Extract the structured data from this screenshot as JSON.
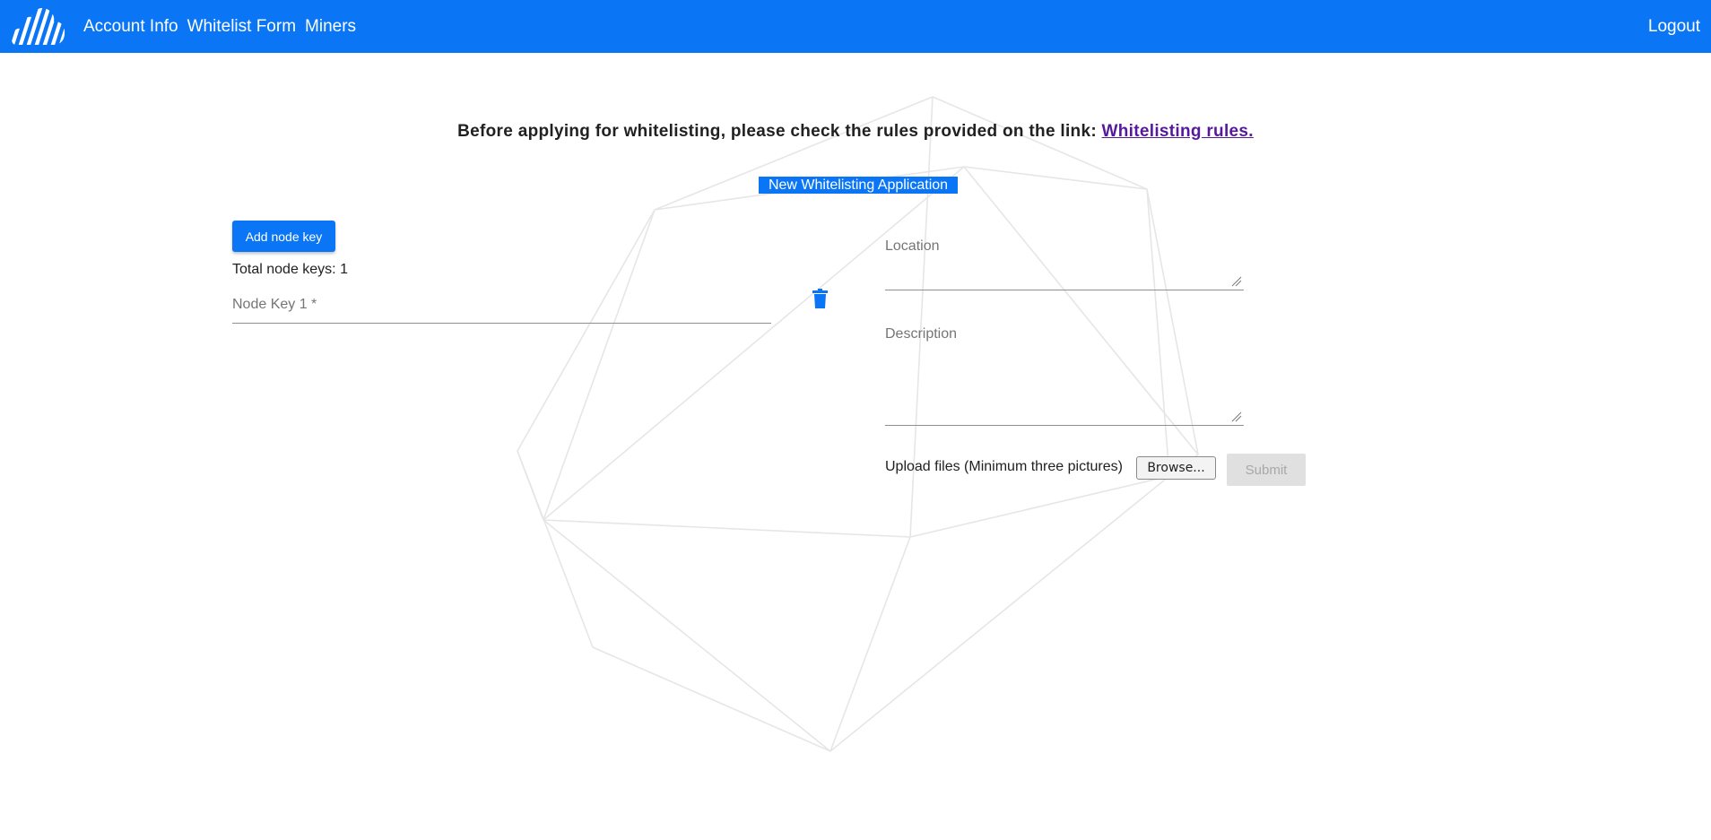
{
  "nav": {
    "logo_icon": "cloud-stripes-icon",
    "links": [
      {
        "label": "Account Info"
      },
      {
        "label": "Whitelist Form"
      },
      {
        "label": "Miners"
      }
    ],
    "logout_label": "Logout"
  },
  "notice": {
    "text": "Before applying for whitelisting, please check the rules provided on the link: ",
    "link_label": "Whitelisting rules."
  },
  "form": {
    "title": "New Whitelisting Application",
    "add_key_label": "Add node key",
    "total_keys_text": "Total node keys: 1",
    "node_key_label": "Node Key 1 *",
    "node_key_value": "",
    "delete_icon": "trash-icon",
    "location_label": "Location",
    "location_value": "",
    "description_label": "Description",
    "description_value": "",
    "upload_label": "Upload files (Minimum three pictures)",
    "browse_label": "Browse...",
    "submit_label": "Submit"
  },
  "colors": {
    "brand": "#0a76f5",
    "link_visited": "#55199b",
    "disabled_bg": "#e0e0e0"
  }
}
